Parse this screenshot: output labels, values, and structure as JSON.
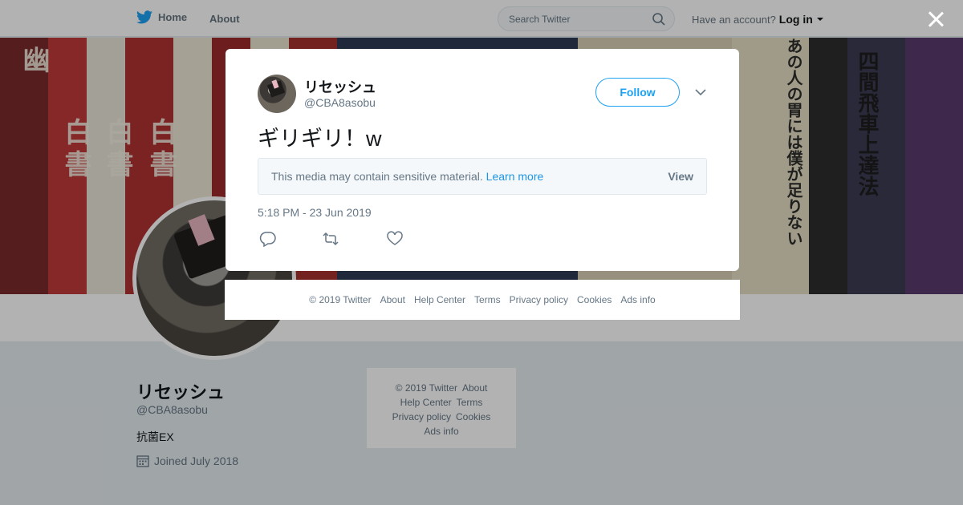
{
  "nav": {
    "home": "Home",
    "about": "About",
    "search_placeholder": "Search Twitter",
    "have_account": "Have an account?",
    "login": "Log in"
  },
  "banner": {
    "spines": [
      "幽",
      "白",
      "書",
      "白",
      "書",
      "白",
      "書",
      "あの人の胃には僕が足りない",
      "四間飛車上達法"
    ]
  },
  "profile": {
    "name": "リセッシュ",
    "handle": "@CBA8asobu",
    "bio": "抗菌EX",
    "joined": "Joined July 2018"
  },
  "side_footer": {
    "line1": [
      "© 2019 Twitter",
      "About"
    ],
    "line2": [
      "Help Center",
      "Terms"
    ],
    "line3": [
      "Privacy policy",
      "Cookies"
    ],
    "line4": [
      "Ads info"
    ]
  },
  "tweet": {
    "name": "リセッシュ",
    "handle": "@CBA8asobu",
    "follow_label": "Follow",
    "text": "ギリギリ！w",
    "sensitive_message": "This media may contain sensitive material.",
    "learn_more": "Learn more",
    "view_label": "View",
    "timestamp": "5:18 PM - 23 Jun 2019",
    "actions": [
      "reply-icon",
      "retweet-icon",
      "like-icon"
    ]
  },
  "modal_footer": {
    "copyright": "© 2019 Twitter",
    "about": "About",
    "help": "Help Center",
    "terms": "Terms",
    "privacy": "Privacy policy",
    "cookies": "Cookies",
    "ads": "Ads info"
  },
  "colors": {
    "accent": "#1da1f2",
    "link": "#1b95e0",
    "text_secondary": "#657786",
    "overlay": "rgba(0,0,0,0.3)"
  }
}
